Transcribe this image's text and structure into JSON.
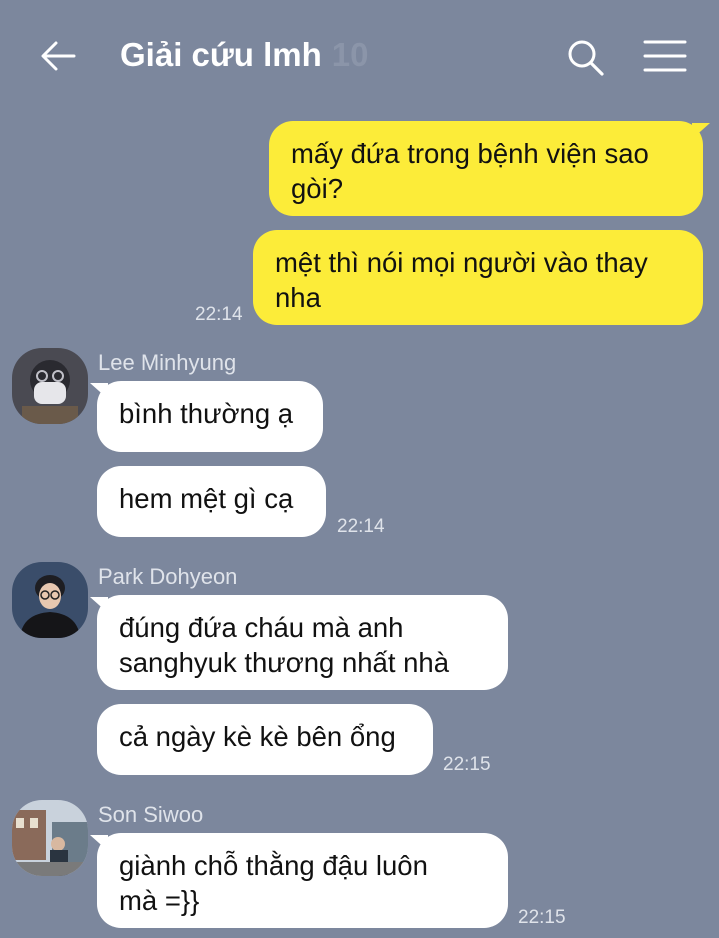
{
  "header": {
    "title": "Giải cứu lmh",
    "member_count": "10"
  },
  "messages": [
    {
      "text_lines": [
        "mấy đứa trong bệnh viện sao",
        "gòi?"
      ]
    },
    {
      "text_lines": [
        "mệt thì nói mọi người vào thay",
        "nha"
      ],
      "time": "22:14"
    },
    {
      "sender": "Lee Minhyung"
    },
    {
      "text_lines": [
        "bình thường ạ"
      ]
    },
    {
      "text_lines": [
        "hem mệt gì cạ"
      ],
      "time": "22:14"
    },
    {
      "sender": "Park Dohyeon"
    },
    {
      "text_lines": [
        "đúng đứa cháu mà anh",
        "sanghyuk thương nhất nhà"
      ]
    },
    {
      "text_lines": [
        "cả ngày kè kè bên ổng"
      ],
      "time": "22:15"
    },
    {
      "sender": "Son Siwoo"
    },
    {
      "text_lines": [
        "giành chỗ thằng đậu luôn",
        "mà =}}"
      ],
      "time": "22:15"
    }
  ],
  "colors": {
    "background": "#7c879d",
    "own_bubble": "#fcec39",
    "other_bubble": "#ffffff"
  }
}
